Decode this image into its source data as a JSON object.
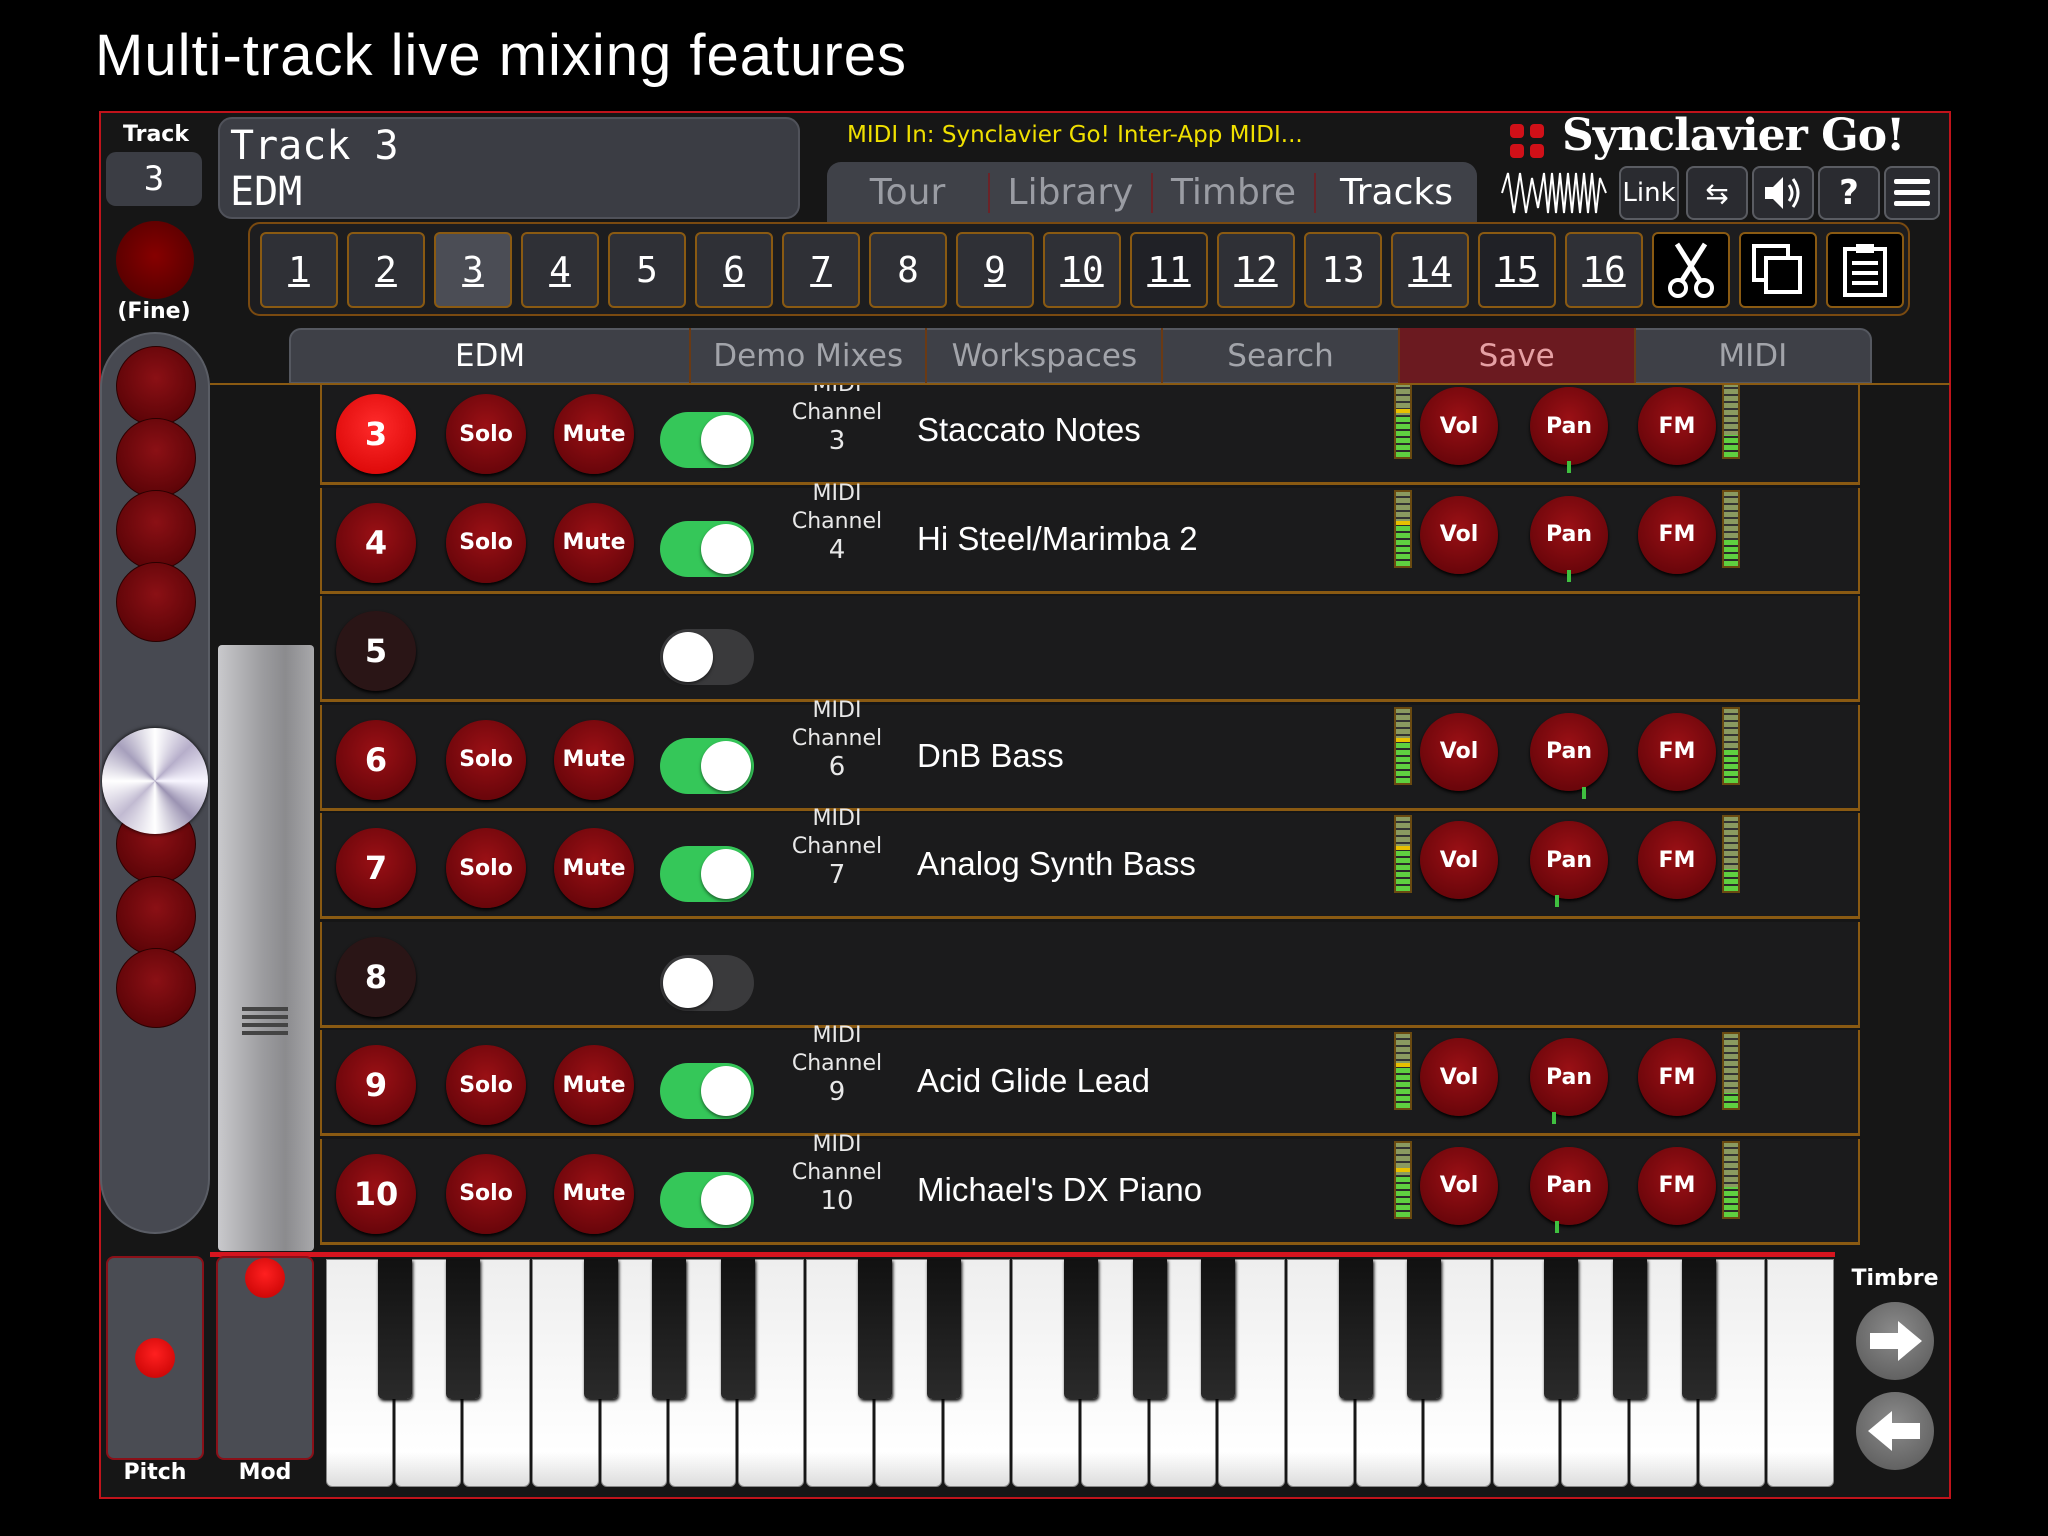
{
  "headline": "Multi-track live mixing features",
  "left": {
    "track_label": "Track",
    "track_number": "3",
    "fine_label": "(Fine)",
    "pitch_label": "Pitch",
    "mod_label": "Mod"
  },
  "header": {
    "track_title": "Track 3",
    "mix_name": "EDM",
    "midi_in": "MIDI In: Synclavier Go! Inter-App MIDI...",
    "logo_text": "Synclavier Go!",
    "link_label": "Link",
    "swap_glyph": "⇆",
    "speaker_glyph": "🔊",
    "help_glyph": "?",
    "menu_glyph": "☰",
    "main_tabs": [
      {
        "label": "Tour"
      },
      {
        "label": "Library"
      },
      {
        "label": "Timbre"
      },
      {
        "label": "Tracks"
      }
    ]
  },
  "track_buttons": [
    {
      "label": "1"
    },
    {
      "label": "2"
    },
    {
      "label": "3"
    },
    {
      "label": "4"
    },
    {
      "label": "5"
    },
    {
      "label": "6"
    },
    {
      "label": "7"
    },
    {
      "label": "8"
    },
    {
      "label": "9"
    },
    {
      "label": "10"
    },
    {
      "label": "11"
    },
    {
      "label": "12"
    },
    {
      "label": "13"
    },
    {
      "label": "14"
    },
    {
      "label": "15"
    },
    {
      "label": "16"
    }
  ],
  "sub_tabs": [
    {
      "label": "EDM"
    },
    {
      "label": "Demo Mixes"
    },
    {
      "label": "Workspaces"
    },
    {
      "label": "Search"
    },
    {
      "label": "Save"
    },
    {
      "label": "MIDI"
    }
  ],
  "row_labels": {
    "solo": "Solo",
    "mute": "Mute",
    "midi": "MIDI",
    "channel": "Channel",
    "vol": "Vol",
    "pan": "Pan",
    "fm": "FM"
  },
  "tracks": [
    {
      "num": "3",
      "enabled": true,
      "channel": "3",
      "name": "Staccato Notes",
      "selected": true,
      "meter_level": 0.55,
      "meter_peak": 0.6,
      "meter2_level": 0.3,
      "pan": 0.0
    },
    {
      "num": "4",
      "enabled": true,
      "channel": "4",
      "name": "Hi Steel/Marimba 2",
      "selected": false,
      "meter_level": 0.55,
      "meter_peak": 0.55,
      "meter2_level": 0.35,
      "pan": 0.0
    },
    {
      "num": "5",
      "enabled": false,
      "channel": "",
      "name": "",
      "selected": false
    },
    {
      "num": "6",
      "enabled": true,
      "channel": "6",
      "name": "DnB Bass",
      "selected": false,
      "meter_level": 0.55,
      "meter_peak": 0.55,
      "meter2_level": 0.45,
      "pan": 0.25
    },
    {
      "num": "7",
      "enabled": true,
      "channel": "7",
      "name": "Analog Synth Bass",
      "selected": false,
      "meter_level": 0.55,
      "meter_peak": 0.55,
      "meter2_level": 0.3,
      "pan": -0.2
    },
    {
      "num": "8",
      "enabled": false,
      "channel": "",
      "name": "",
      "selected": false
    },
    {
      "num": "9",
      "enabled": true,
      "channel": "9",
      "name": "Acid Glide Lead",
      "selected": false,
      "meter_level": 0.55,
      "meter_peak": 0.55,
      "meter2_level": 0.2,
      "pan": -0.25
    },
    {
      "num": "10",
      "enabled": true,
      "channel": "10",
      "name": "Michael's DX Piano",
      "selected": false,
      "meter_level": 0.55,
      "meter_peak": 0.6,
      "meter2_level": 0.4,
      "pan": -0.2
    }
  ],
  "timbre_label": "Timbre",
  "colors": {
    "accent": "#c0131b",
    "toggle_on": "#35c759",
    "midi_in_text": "#f0e000",
    "gold_border": "#8a5a12"
  }
}
